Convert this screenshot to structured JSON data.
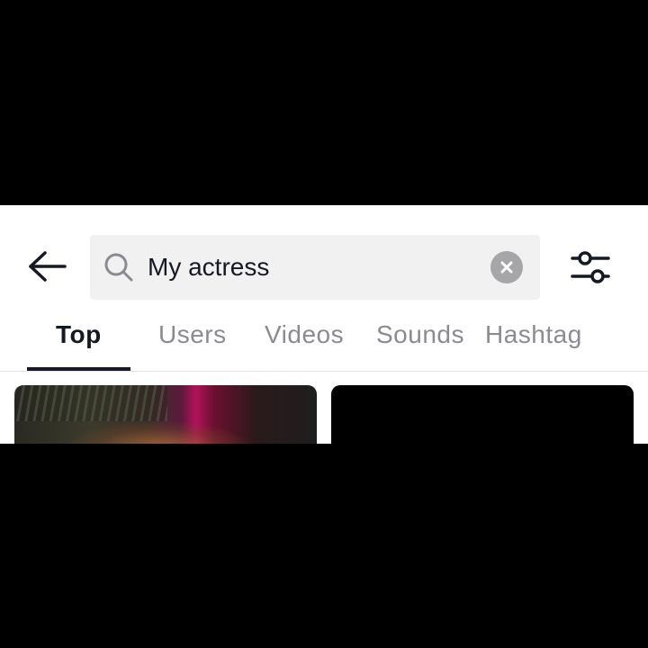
{
  "search": {
    "query": "My actress"
  },
  "tabs": [
    {
      "label": "Top",
      "active": true
    },
    {
      "label": "Users",
      "active": false
    },
    {
      "label": "Videos",
      "active": false
    },
    {
      "label": "Sounds",
      "active": false
    },
    {
      "label": "Hashtag",
      "active": false
    }
  ],
  "icons": {
    "back": "arrow-left-icon",
    "search": "search-icon",
    "clear": "clear-icon",
    "filter": "filter-sliders-icon"
  },
  "colors": {
    "active_text": "#161823",
    "inactive_text": "#8a8b91",
    "search_bg": "#f1f1f2"
  }
}
